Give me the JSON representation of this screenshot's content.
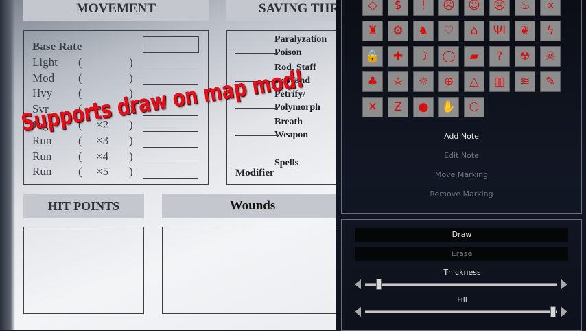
{
  "sheet": {
    "movement_header": "MOVEMENT",
    "saving_header": "SAVING THROWS",
    "hitpoints_header": "HIT POINTS",
    "wounds_header": "Wounds",
    "movement_rows": [
      {
        "label": "Base Rate",
        "mult": ""
      },
      {
        "label": "Light",
        "mult": ""
      },
      {
        "label": "Mod",
        "mult": ""
      },
      {
        "label": "Hvy",
        "mult": ""
      },
      {
        "label": "Svr",
        "mult": ""
      },
      {
        "label": "Jog",
        "mult": "×2"
      },
      {
        "label": "Run",
        "mult": "×3"
      },
      {
        "label": "Run",
        "mult": "×4"
      },
      {
        "label": "Run",
        "mult": "×5"
      }
    ],
    "saves": [
      {
        "line1": "Paralyzation",
        "line2": "Poison"
      },
      {
        "line1": "Rod, Staff",
        "line2": "or Wand"
      },
      {
        "line1": "Petrify/",
        "line2": "Polymorph"
      },
      {
        "line1": "Breath",
        "line2": "Weapon"
      },
      {
        "line1": "Spells",
        "line2": ""
      }
    ],
    "modifier_label": "Modifier"
  },
  "caption": "Supports draw on map mod!",
  "panel": {
    "icons": [
      {
        "name": "diamond-icon",
        "glyph": "◇"
      },
      {
        "name": "dollar-icon",
        "glyph": "$"
      },
      {
        "name": "exclamation-icon",
        "glyph": "!"
      },
      {
        "name": "angry-face-icon",
        "glyph": "☹"
      },
      {
        "name": "smile-face-icon",
        "glyph": "☺"
      },
      {
        "name": "neutral-face-icon",
        "glyph": "☹"
      },
      {
        "name": "flame-icon",
        "glyph": "♨"
      },
      {
        "name": "fish-icon",
        "glyph": "∝"
      },
      {
        "name": "bucket-icon",
        "glyph": "♜"
      },
      {
        "name": "gear-icon",
        "glyph": "⚙"
      },
      {
        "name": "boot-icon",
        "glyph": "♞"
      },
      {
        "name": "heart-icon",
        "glyph": "♡"
      },
      {
        "name": "house-icon",
        "glyph": "⌂"
      },
      {
        "name": "fork-knife-icon",
        "glyph": "ΨΙ"
      },
      {
        "name": "leaf-icon",
        "glyph": "❦"
      },
      {
        "name": "lightning-icon",
        "glyph": "ϟ"
      },
      {
        "name": "lock-icon",
        "glyph": "🔒"
      },
      {
        "name": "medical-cross-icon",
        "glyph": "✚"
      },
      {
        "name": "moon-icon",
        "glyph": "☽"
      },
      {
        "name": "ring-icon",
        "glyph": "◯"
      },
      {
        "name": "bandage-icon",
        "glyph": "▰"
      },
      {
        "name": "question-icon",
        "glyph": "?"
      },
      {
        "name": "radiation-icon",
        "glyph": "☢"
      },
      {
        "name": "skull-icon",
        "glyph": "☠"
      },
      {
        "name": "dragon-icon",
        "glyph": "♣"
      },
      {
        "name": "pentagram-icon",
        "glyph": "⛤"
      },
      {
        "name": "sun-icon",
        "glyph": "☼"
      },
      {
        "name": "crosshair-icon",
        "glyph": "⊕"
      },
      {
        "name": "tent-icon",
        "glyph": "△"
      },
      {
        "name": "bars-icon",
        "glyph": "▥"
      },
      {
        "name": "waves-icon",
        "glyph": "≋"
      },
      {
        "name": "wrench-icon",
        "glyph": "✎"
      },
      {
        "name": "x-mark-icon",
        "glyph": "✕"
      },
      {
        "name": "z-mark-icon",
        "glyph": "Ƶ"
      },
      {
        "name": "dot-icon",
        "glyph": "●"
      },
      {
        "name": "claw-icon",
        "glyph": "✋"
      },
      {
        "name": "cube-icon",
        "glyph": "⬡"
      }
    ],
    "menu": [
      {
        "label": "Add Note",
        "enabled": true
      },
      {
        "label": "Edit Note",
        "enabled": false
      },
      {
        "label": "Move Marking",
        "enabled": false
      },
      {
        "label": "Remove Marking",
        "enabled": false
      }
    ],
    "draw_label": "Draw",
    "erase_label": "Erase",
    "thickness_label": "Thickness",
    "thickness_value": 0.07,
    "fill_label": "Fill",
    "fill_value": 0.98,
    "accent_color": "#d90d0d"
  }
}
